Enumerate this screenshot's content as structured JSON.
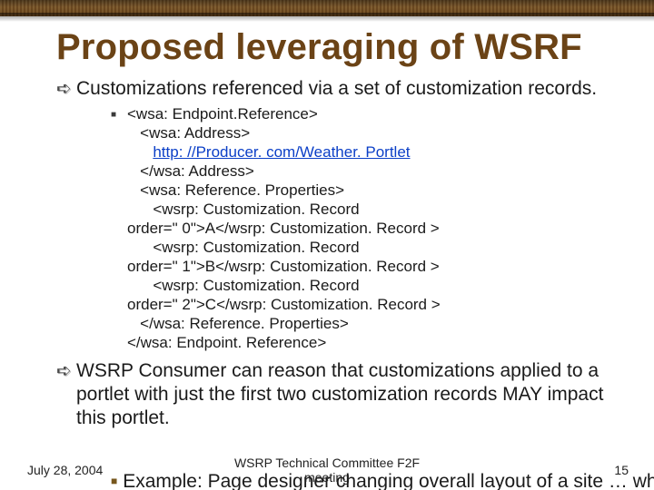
{
  "title": "Proposed leveraging of WSRF",
  "bullets": {
    "b1": "Customizations referenced via a set of customization records.",
    "b2": "WSRP Consumer can reason that customizations applied to a portlet with just the first two customization records MAY impact this portlet."
  },
  "code": {
    "l1": "<wsa: Endpoint.Reference>",
    "l2": "   <wsa: Address>",
    "l3_prefix": "      ",
    "l3_link": "http: //Producer. com/Weather. Portlet",
    "l4": "   </wsa: Address>",
    "l5": "   <wsa: Reference. Properties>",
    "l6": "      <wsrp: Customization. Record",
    "l7": "order=\" 0\">A</wsrp: Customization. Record >",
    "l8": "      <wsrp: Customization. Record",
    "l9": "order=\" 1\">B</wsrp: Customization. Record >",
    "l10": "      <wsrp: Customization. Record",
    "l11": "order=\" 2\">C</wsrp: Customization. Record >",
    "l12": "   </wsa: Reference. Properties>",
    "l13": "</wsa: Endpoint. Reference>"
  },
  "cutoff": "Example: Page designer changing overall layout of a site … which",
  "footer": {
    "date": "July 28, 2004",
    "center1": "WSRP Technical Committee F2F",
    "center2": "meeting",
    "page": "15"
  }
}
